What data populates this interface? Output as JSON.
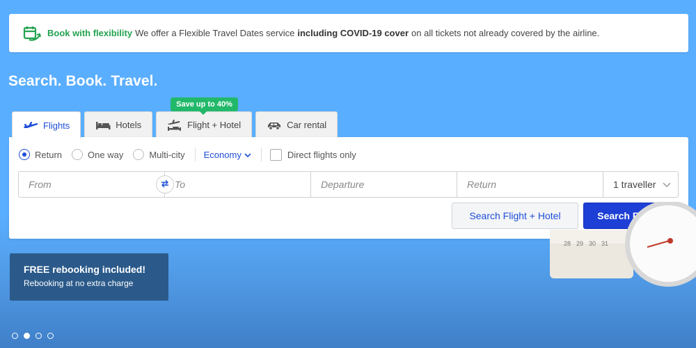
{
  "banner": {
    "title": "Book with flexibility",
    "text1": "We offer a Flexible Travel Dates service",
    "bold": "including COVID-19 cover",
    "text2": "on all tickets not already covered by the airline."
  },
  "headline": "Search. Book. Travel.",
  "tabs": [
    {
      "label": "Flights",
      "icon": "plane-icon"
    },
    {
      "label": "Hotels",
      "icon": "bed-icon"
    },
    {
      "label": "Flight + Hotel",
      "icon": "plane-hotel-icon",
      "badge": "Save up to 40%"
    },
    {
      "label": "Car rental",
      "icon": "car-icon"
    }
  ],
  "trip_options": {
    "return": "Return",
    "one_way": "One way",
    "multi_city": "Multi-city",
    "selected": "Return"
  },
  "cabin_class": "Economy",
  "direct_only": "Direct flights only",
  "fields": {
    "from_placeholder": "From",
    "to_placeholder": "To",
    "departure_placeholder": "Departure",
    "return_placeholder": "Return",
    "travellers": "1 traveller"
  },
  "buttons": {
    "search_flight_hotel": "Search Flight + Hotel",
    "search_flights": "Search Flights"
  },
  "promo": {
    "line1": "FREE rebooking included!",
    "line2": "Rebooking at no extra charge"
  },
  "calendar_numbers": [
    "28",
    "29",
    "30",
    "31"
  ],
  "colors": {
    "accent": "#1d4ed8",
    "primary_button": "#1d3fd6",
    "flex_green": "#23a34f",
    "badge_green": "#22b86a",
    "promo_bg": "#2b5a8a"
  },
  "carousel": {
    "count": 4,
    "active_index": 1
  }
}
